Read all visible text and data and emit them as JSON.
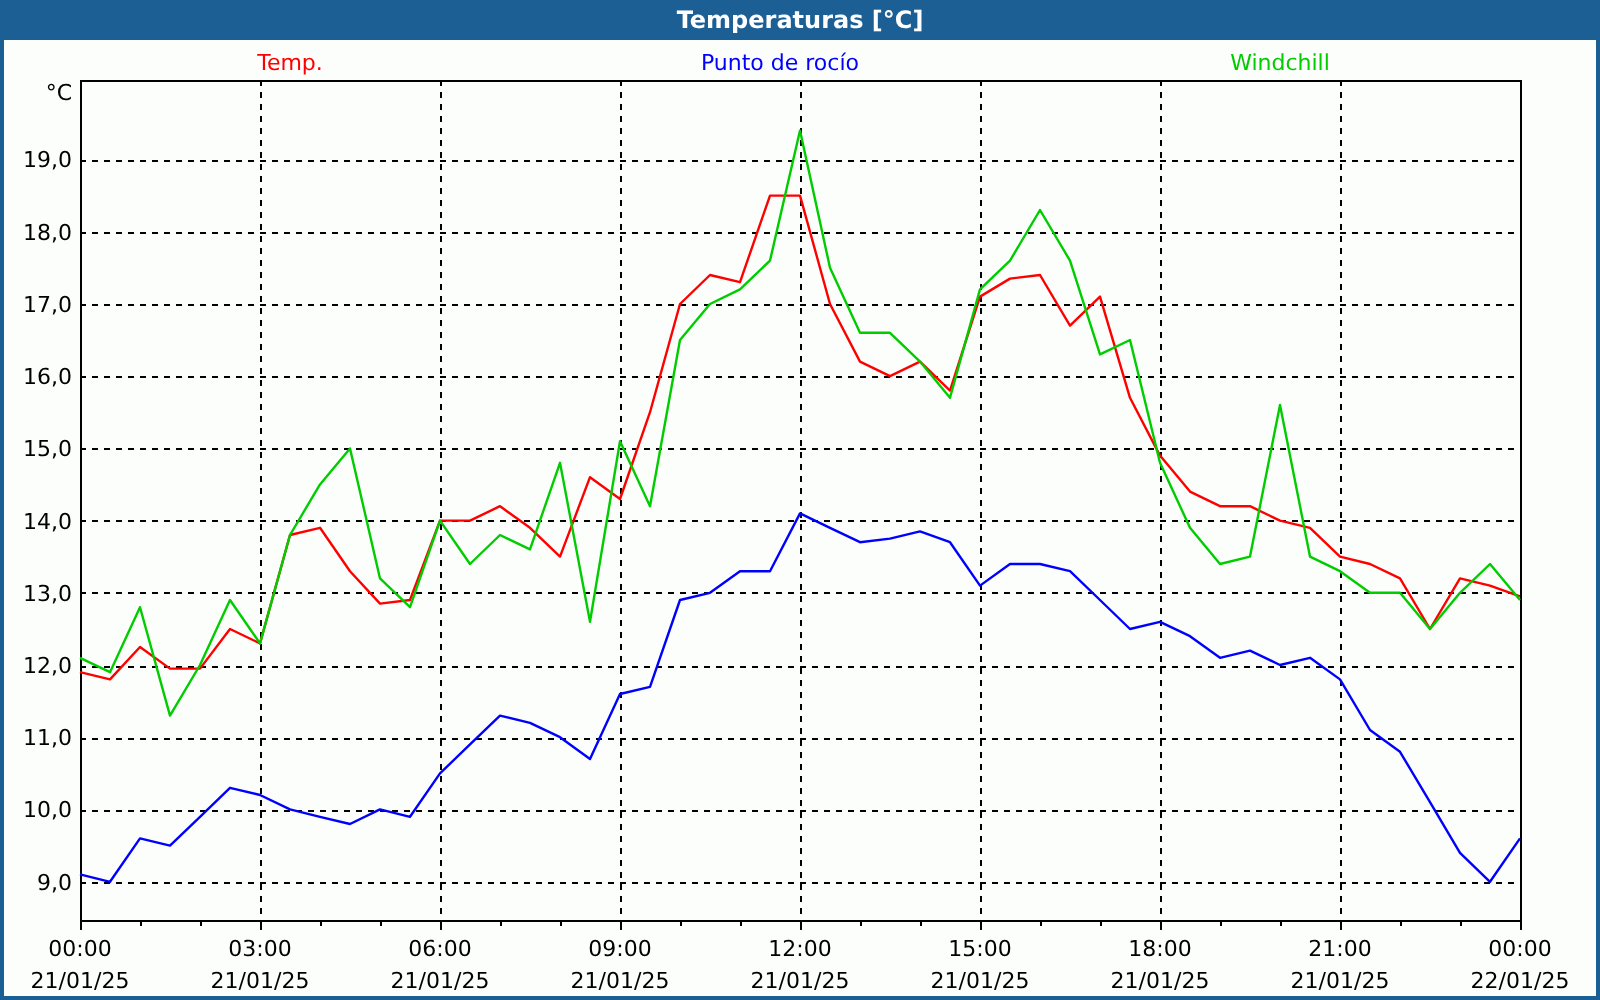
{
  "window": {
    "title": "Temperaturas [°C]"
  },
  "chart": {
    "chart_data": {
      "type": "line",
      "ylabel": "°C",
      "categories": [
        "00:00\n21/01/25",
        null,
        null,
        null,
        null,
        null,
        "03:00\n21/01/25",
        null,
        null,
        null,
        null,
        null,
        "06:00\n21/01/25",
        null,
        null,
        null,
        null,
        null,
        "09:00\n21/01/25",
        null,
        null,
        null,
        null,
        null,
        "12:00\n21/01/25",
        null,
        null,
        null,
        null,
        null,
        "15:00\n21/01/25",
        null,
        null,
        null,
        null,
        null,
        "18:00\n21/01/25",
        null,
        null,
        null,
        null,
        null,
        "21:00\n21/01/25",
        null,
        null,
        null,
        null,
        null,
        "00:00\n22/01/25"
      ],
      "ylim": [
        8.47,
        20.1
      ],
      "grid": true,
      "yticks": [
        {
          "value": 9,
          "label": "9,0"
        },
        {
          "value": 10,
          "label": "10,0"
        },
        {
          "value": 11,
          "label": "11,0"
        },
        {
          "value": 12,
          "label": "12,0"
        },
        {
          "value": 13,
          "label": "13,0"
        },
        {
          "value": 14,
          "label": "14,0"
        },
        {
          "value": 15,
          "label": "15,0"
        },
        {
          "value": 16,
          "label": "16,0"
        },
        {
          "value": 17,
          "label": "17,0"
        },
        {
          "value": 18,
          "label": "18,0"
        },
        {
          "value": 19,
          "label": "19,0"
        }
      ],
      "series": [
        {
          "name": "Temp.",
          "color": "#ff0000",
          "values": [
            11.9,
            11.8,
            12.25,
            11.95,
            11.95,
            12.5,
            12.3,
            13.8,
            13.9,
            13.3,
            12.85,
            12.9,
            14.0,
            14.0,
            14.2,
            13.9,
            13.5,
            14.6,
            14.3,
            15.5,
            17.0,
            17.4,
            17.3,
            18.5,
            18.5,
            17.0,
            16.2,
            16.0,
            16.2,
            15.8,
            17.1,
            17.35,
            17.4,
            16.7,
            17.1,
            15.7,
            14.9,
            14.4,
            14.2,
            14.2,
            14.0,
            13.9,
            13.5,
            13.4,
            13.2,
            12.5,
            13.2,
            13.1,
            12.95
          ]
        },
        {
          "name": "Punto de rocío",
          "color": "#0000ff",
          "values": [
            9.1,
            9.0,
            9.6,
            9.5,
            9.9,
            10.3,
            10.2,
            10.0,
            9.9,
            9.8,
            10.0,
            9.9,
            10.5,
            10.9,
            11.3,
            11.2,
            11.0,
            10.7,
            11.6,
            11.7,
            12.9,
            13.0,
            13.3,
            13.3,
            14.1,
            13.9,
            13.7,
            13.75,
            13.85,
            13.7,
            13.1,
            13.4,
            13.4,
            13.3,
            12.9,
            12.5,
            12.6,
            12.4,
            12.1,
            12.2,
            12.0,
            12.1,
            11.8,
            11.1,
            10.8,
            10.1,
            9.4,
            9.0,
            9.6
          ]
        },
        {
          "name": "Windchill",
          "color": "#00cc00",
          "values": [
            12.1,
            11.9,
            12.8,
            11.3,
            12.0,
            12.9,
            12.3,
            13.8,
            14.5,
            15.0,
            13.2,
            12.8,
            14.0,
            13.4,
            13.8,
            13.6,
            14.8,
            12.6,
            15.1,
            14.2,
            16.5,
            17.0,
            17.2,
            17.6,
            19.4,
            17.5,
            16.6,
            16.6,
            16.2,
            15.7,
            17.2,
            17.6,
            18.3,
            17.6,
            16.3,
            16.5,
            14.8,
            13.9,
            13.4,
            13.5,
            15.6,
            13.5,
            13.3,
            13.0,
            13.0,
            12.5,
            13.0,
            13.4,
            12.9
          ]
        }
      ]
    }
  }
}
